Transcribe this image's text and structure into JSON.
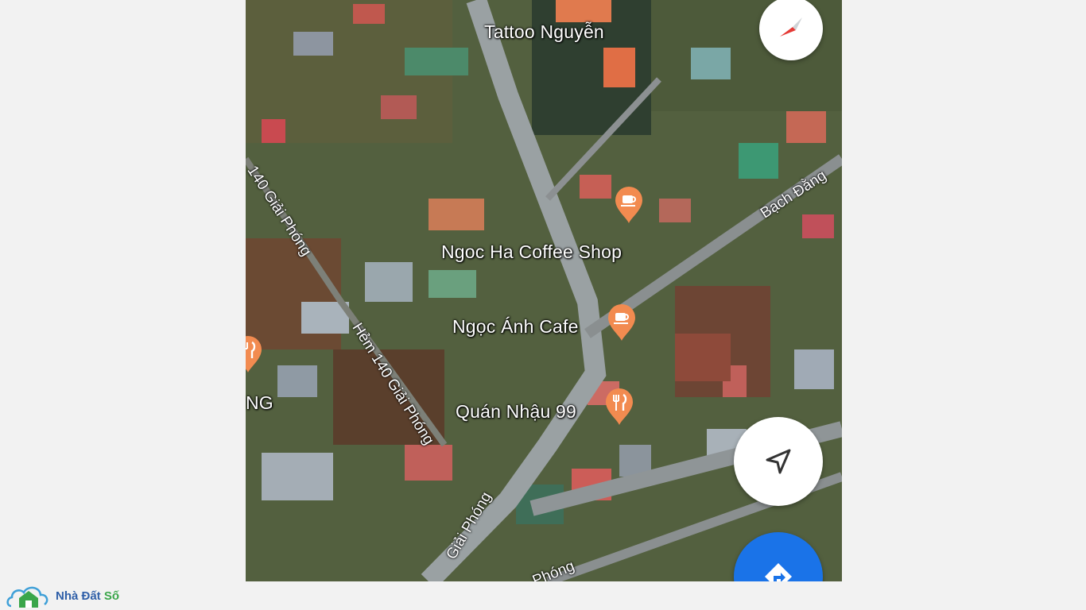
{
  "map": {
    "places": [
      {
        "name": "Tattoo Nguyễn",
        "icon": "none"
      },
      {
        "name": "Ngoc Ha Coffee Shop",
        "icon": "coffee-pin-icon"
      },
      {
        "name": "Ngọc Ánh Cafe",
        "icon": "coffee-pin-icon"
      },
      {
        "name": "Quán Nhậu 99",
        "icon": "restaurant-pin-icon"
      },
      {
        "name": "NG",
        "icon": "restaurant-pin-icon"
      }
    ],
    "roads": [
      {
        "name": "140 Giải Phóng"
      },
      {
        "name": "Hẻm 140 Giải Phóng"
      },
      {
        "name": "Giải Phóng"
      },
      {
        "name": "Bạch Đằng"
      },
      {
        "name": "Phóng"
      }
    ],
    "controls": {
      "compass": "compass-icon",
      "locate": "navigation-arrow-icon",
      "directions": "directions-icon"
    },
    "colors": {
      "pin": "#f28b50",
      "directions_button": "#1a73e8",
      "compass_needle": "#e53935"
    }
  },
  "watermark": {
    "brand_main": "Nhà Đất ",
    "brand_accent": "Số"
  }
}
